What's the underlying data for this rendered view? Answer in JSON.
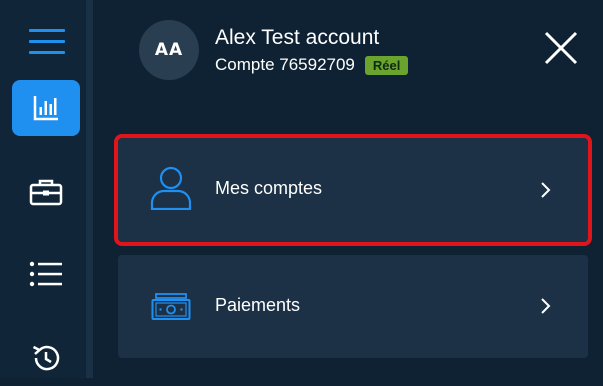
{
  "account": {
    "initials": "AA",
    "name": "Alex Test account",
    "number_label": "Compte 76592709",
    "status_badge": "Réel"
  },
  "menu": {
    "items": [
      {
        "label": "Mes comptes",
        "icon": "user-icon",
        "selected": true
      },
      {
        "label": "Paiements",
        "icon": "banknote-icon",
        "selected": false
      }
    ]
  },
  "sidebar": {
    "icons": [
      "menu-icon",
      "bar-chart-icon",
      "briefcase-icon",
      "list-icon",
      "history-icon"
    ],
    "active": "bar-chart-icon"
  },
  "colors": {
    "accent": "#1f8ff0",
    "badge": "#6aa42e",
    "highlight": "#e0151b",
    "card": "#1c3146",
    "background": "#0f2233"
  }
}
